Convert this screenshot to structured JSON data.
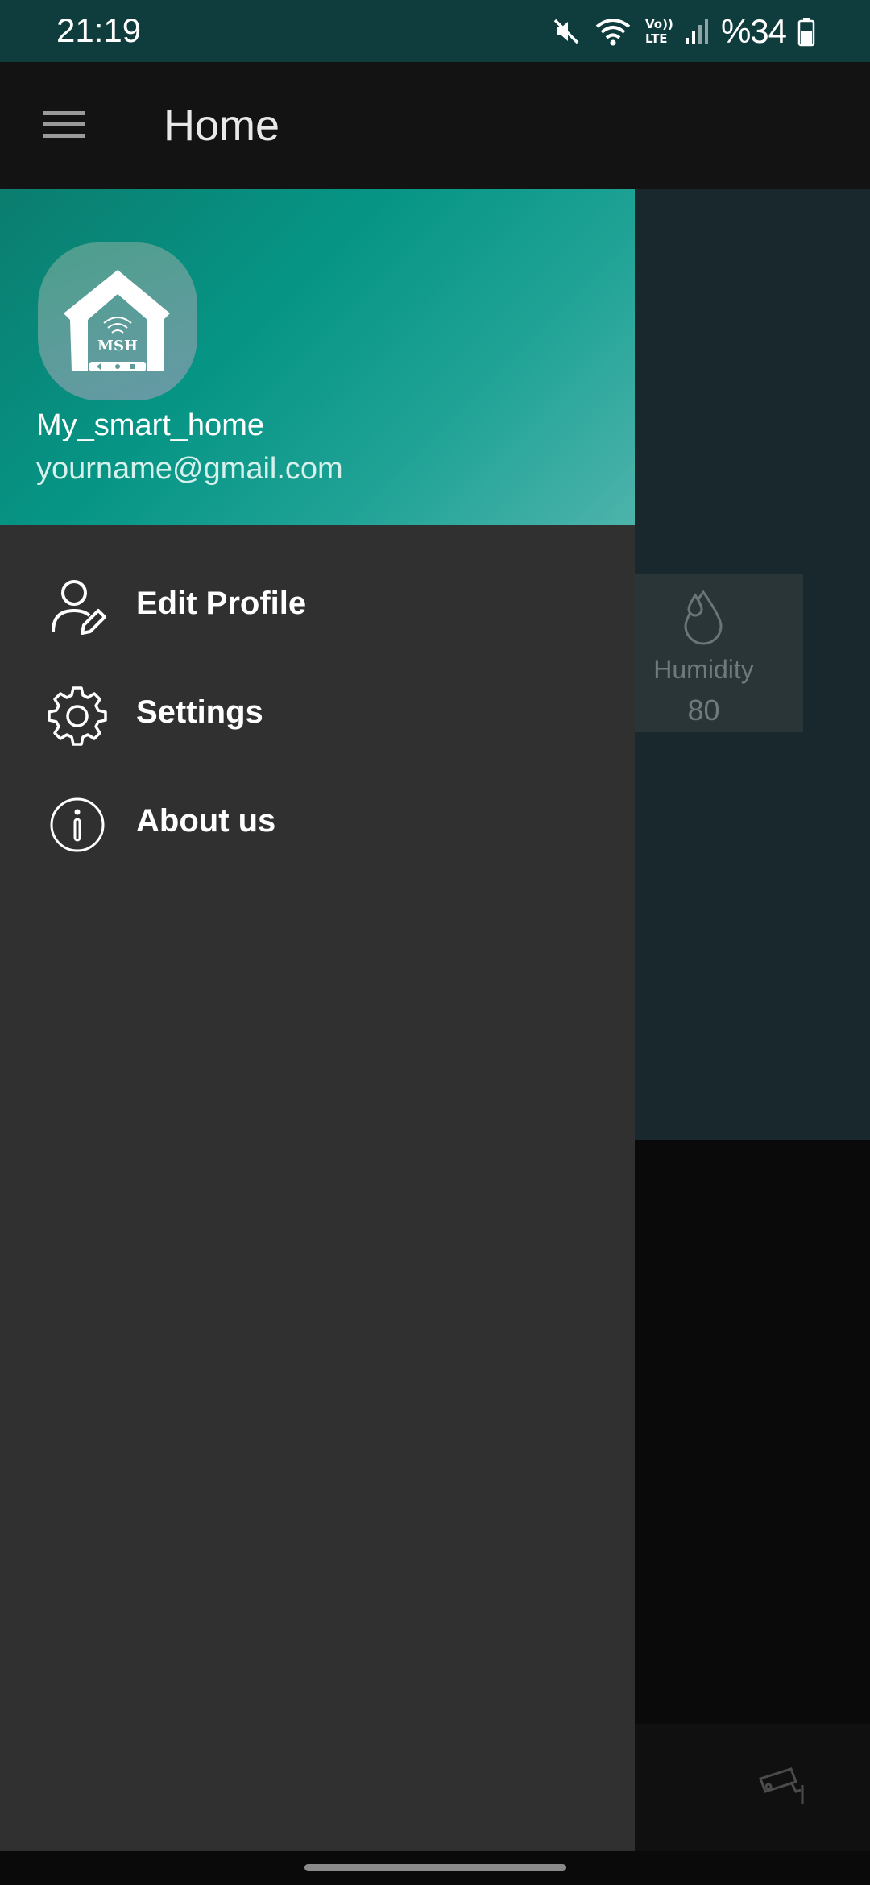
{
  "status_bar": {
    "time": "21:19",
    "battery": "%34",
    "icons": [
      "mute-icon",
      "wifi-icon",
      "volte-icon",
      "signal-icon",
      "battery-icon"
    ]
  },
  "app_bar": {
    "title": "Home",
    "menu_icon": "hamburger-menu-icon"
  },
  "drawer": {
    "header": {
      "logo_text": "MSH",
      "username": "My_smart_home",
      "email": "yourname@gmail.com"
    },
    "items": [
      {
        "label": "Edit Profile",
        "icon": "user-edit-icon"
      },
      {
        "label": "Settings",
        "icon": "gear-icon"
      },
      {
        "label": "About us",
        "icon": "info-icon"
      }
    ]
  },
  "background": {
    "humidity_card": {
      "label": "Humidity",
      "value": "80",
      "icon": "water-drop-icon"
    },
    "bottom_nav": {
      "icon": "security-camera-icon"
    }
  },
  "colors": {
    "status_bar": "#0f3c3c",
    "app_bar": "#131313",
    "drawer_bg": "#303030",
    "header_gradient_start": "#0b7d6f",
    "header_gradient_end": "#4db3ab"
  }
}
